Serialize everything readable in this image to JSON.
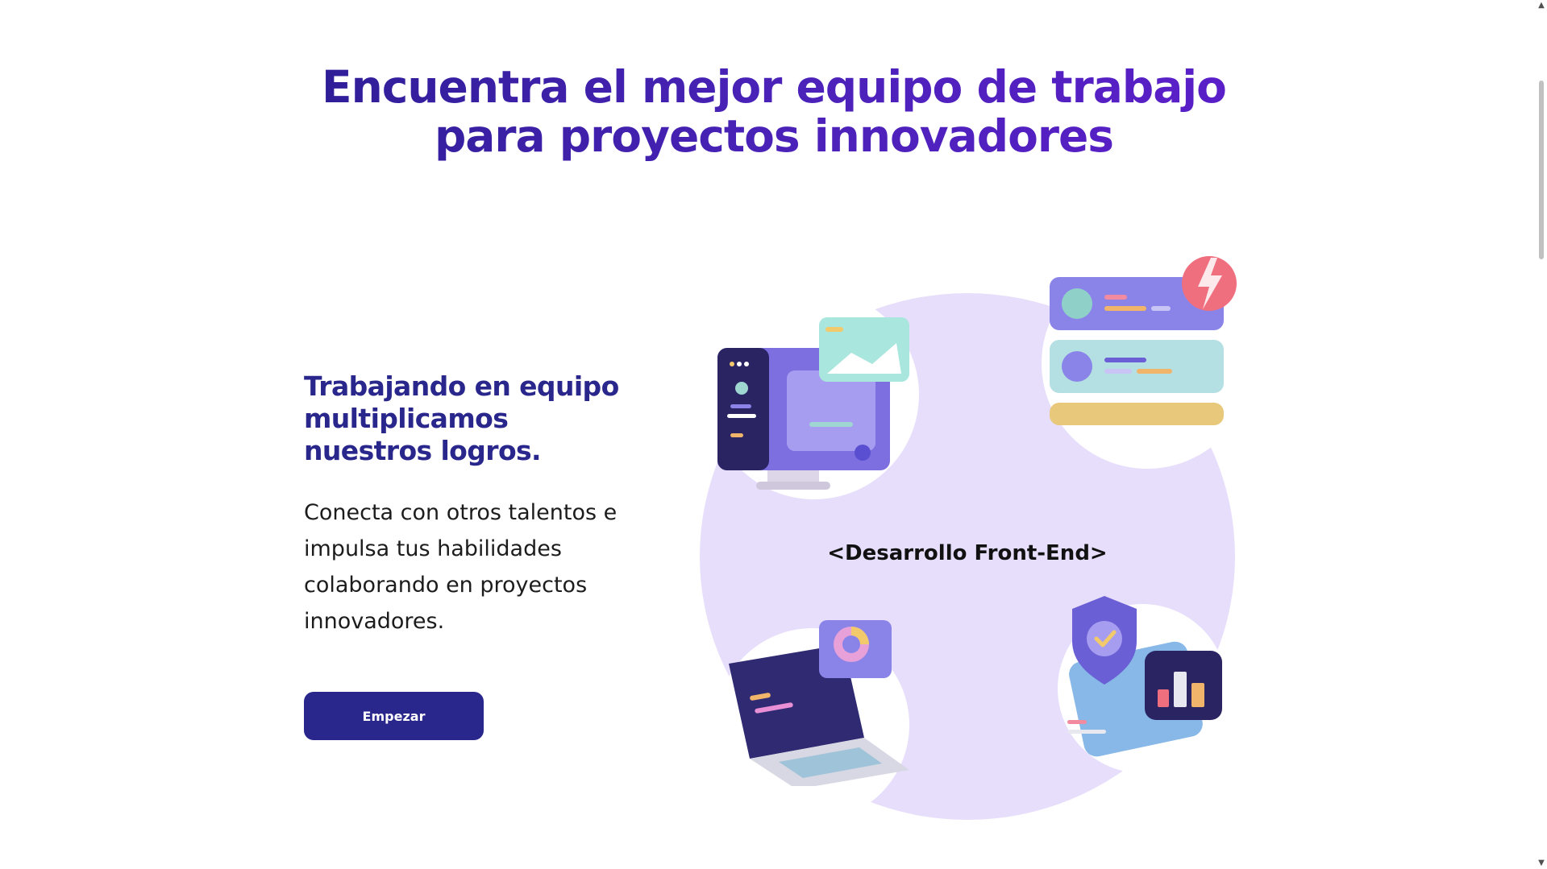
{
  "hero": {
    "title_line1": "Encuentra el mejor equipo de trabajo",
    "title_line2": "para proyectos innovadores"
  },
  "intro": {
    "subtitle": "Trabajando en equipo multiplicamos nuestros logros.",
    "description": "Conecta con otros talentos e impulsa tus habilidades colaborando en proyectos innovadores.",
    "cta_label": "Empezar"
  },
  "illustration": {
    "center_label": "<Desarrollo Front-End>",
    "icons": [
      "desktop-monitor-icon",
      "profile-cards-icon",
      "laptop-icon",
      "security-dashboard-icon"
    ]
  },
  "colors": {
    "title_gradient_start": "#2e1e96",
    "title_gradient_end": "#5b1fc9",
    "brand_navy": "#29268c",
    "blob_lavender": "#e7defb"
  },
  "scrollbar": {
    "up_arrow": "▲",
    "down_arrow": "▼"
  }
}
